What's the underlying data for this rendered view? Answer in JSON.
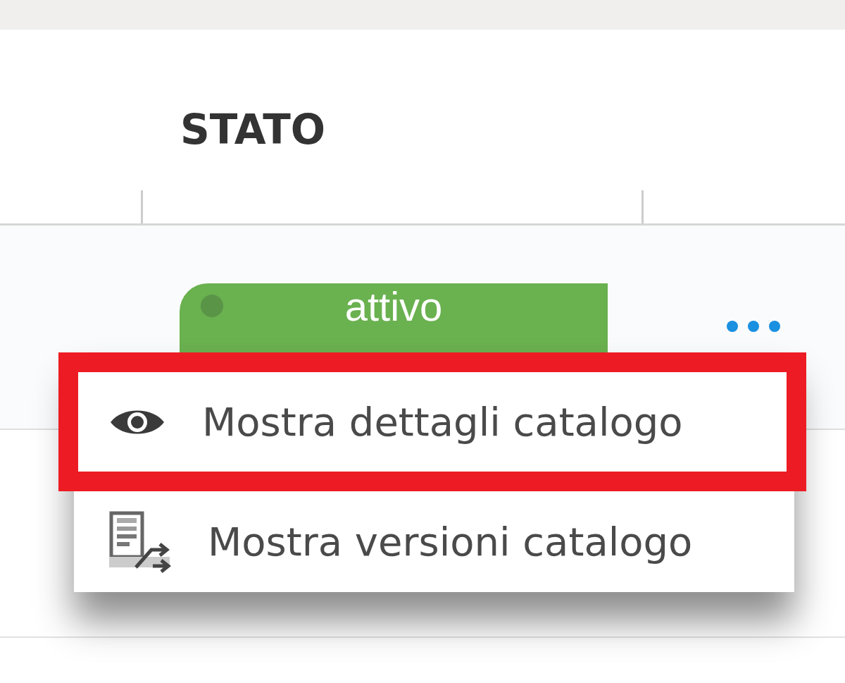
{
  "table": {
    "columns": [
      {
        "label": "STATO"
      }
    ],
    "rows": [
      {
        "status": "attivo"
      }
    ]
  },
  "menu": {
    "items": [
      {
        "kind": "eye",
        "label": "Mostra dettagli catalogo",
        "highlighted": true
      },
      {
        "kind": "versions",
        "label": "Mostra versioni catalogo",
        "highlighted": false
      }
    ]
  }
}
